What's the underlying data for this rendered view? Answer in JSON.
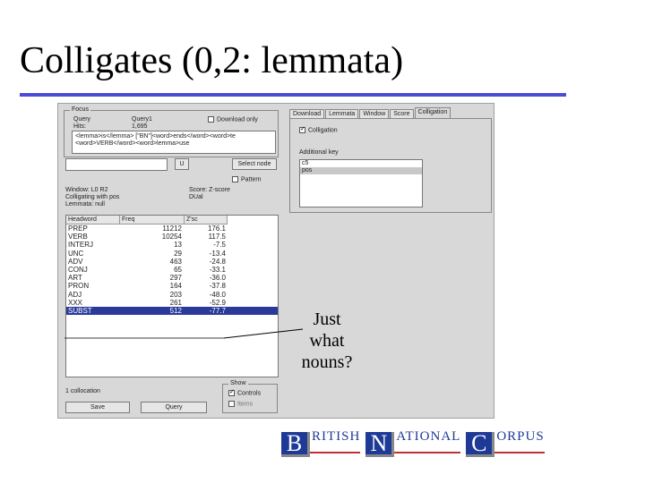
{
  "slide": {
    "title": "Colligates (0,2: lemmata)",
    "annotation": [
      "Just",
      "what",
      "nouns?"
    ]
  },
  "app": {
    "focus": {
      "legend": "Focus",
      "query_label": "Query",
      "query_value": "Query1",
      "hits_label": "Hits:",
      "hits_value": "1,695",
      "download_only_label": "Download only",
      "query_text": [
        "<lemma>is</lemma> [\"BN\"]<word>ends</word><word>te",
        "<word>VERB</word><word>lemma>use"
      ]
    },
    "select_button": "Select node",
    "u_button": "U",
    "pattern_label": "Pattern",
    "pattern_checked": false,
    "info": {
      "window": "Window: L0 R2",
      "score": "Score: Z-score",
      "colligating": "Colligating with pos",
      "lemmata": "Lemmata: null",
      "dual": "DUal"
    },
    "results": {
      "columns": [
        "Headword",
        "Freq",
        "Z'sc"
      ],
      "rows": [
        {
          "headword": "PREP",
          "freq": "11212",
          "score": "176.1"
        },
        {
          "headword": "VERB",
          "freq": "10254",
          "score": "117.5"
        },
        {
          "headword": "INTERJ",
          "freq": "13",
          "score": "-7.5"
        },
        {
          "headword": "UNC",
          "freq": "29",
          "score": "-13.4"
        },
        {
          "headword": "ADV",
          "freq": "463",
          "score": "-24.8"
        },
        {
          "headword": "CONJ",
          "freq": "65",
          "score": "-33.1"
        },
        {
          "headword": "ART",
          "freq": "297",
          "score": "-36.0"
        },
        {
          "headword": "PRON",
          "freq": "164",
          "score": "-37.8"
        },
        {
          "headword": "ADJ",
          "freq": "203",
          "score": "-48.0"
        },
        {
          "headword": "XXX",
          "freq": "261",
          "score": "-52.9"
        },
        {
          "headword": "SUBST",
          "freq": "512",
          "score": "-77.7"
        }
      ],
      "selected_index": 10
    },
    "footer_status": "1 collocation",
    "save_button": "Save",
    "query_button": "Query",
    "show": {
      "legend": "Show",
      "items": [
        {
          "label": "Controls",
          "checked": true
        },
        {
          "label": "Items",
          "checked": false
        }
      ]
    },
    "tabs": [
      "Download",
      "Lemmata",
      "Window",
      "Score",
      "Colligation"
    ],
    "active_tab": 4,
    "colligation_checkbox": {
      "label": "Colligation",
      "checked": true
    },
    "additional_key": {
      "label": "Additional key",
      "items": [
        "c5",
        "pos"
      ],
      "selected_index": 1
    }
  },
  "logo": {
    "words": [
      {
        "initial": "B",
        "rest": "RITISH"
      },
      {
        "initial": "N",
        "rest": "ATIONAL"
      },
      {
        "initial": "C",
        "rest": "ORPUS"
      }
    ]
  }
}
